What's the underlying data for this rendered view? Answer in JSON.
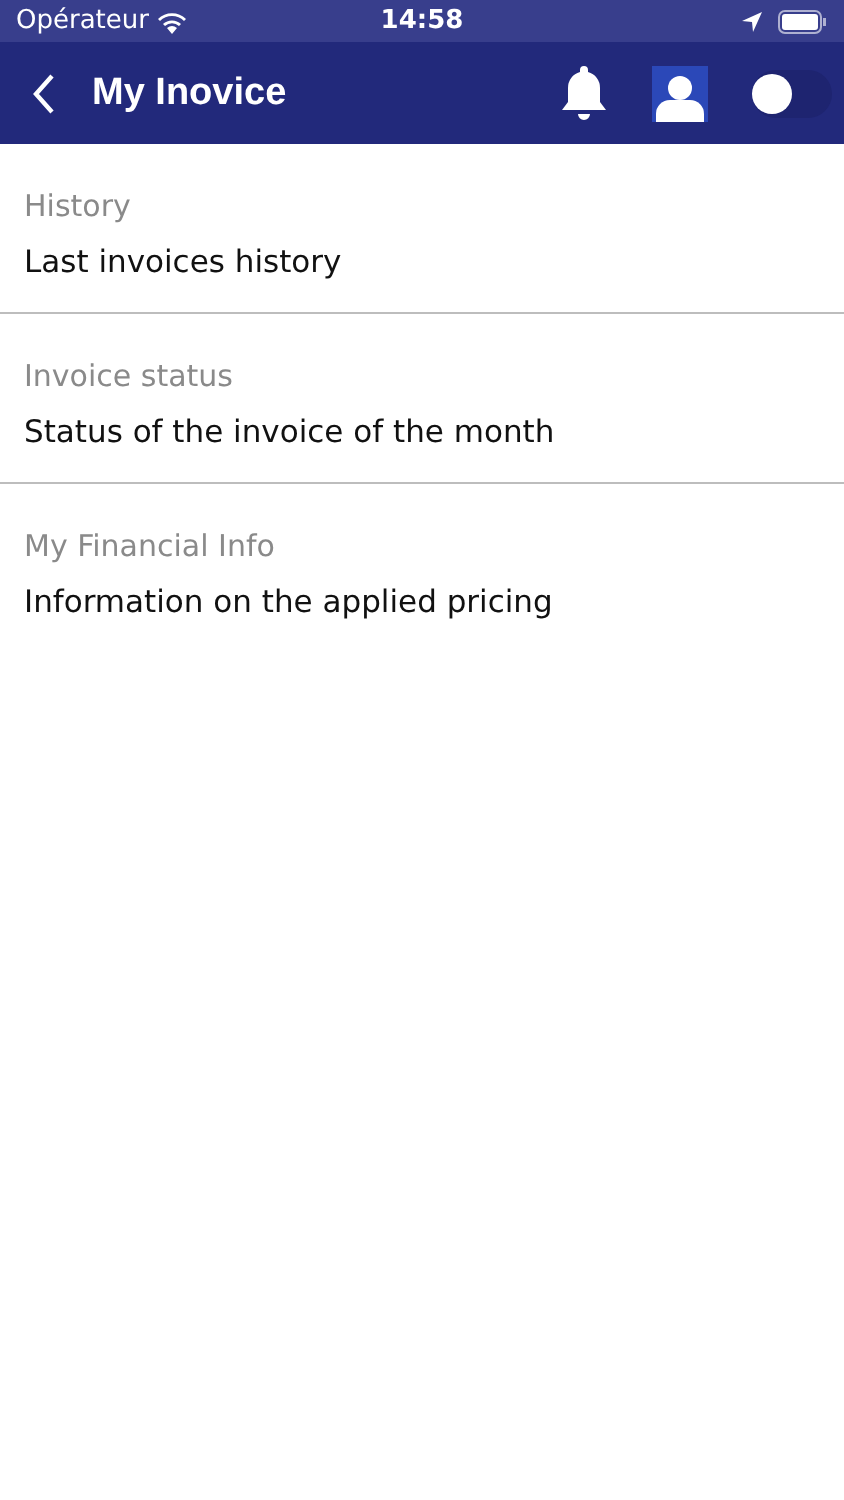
{
  "status_bar": {
    "carrier": "Opérateur",
    "time": "14:58"
  },
  "nav_bar": {
    "title": "My Inovice",
    "toggle": {
      "on": false
    }
  },
  "sections": [
    {
      "header": "History",
      "item": "Last invoices history"
    },
    {
      "header": "Invoice status",
      "item": "Status of the invoice of the month"
    },
    {
      "header": "My Financial Info",
      "item": "Information on the applied pricing"
    }
  ]
}
